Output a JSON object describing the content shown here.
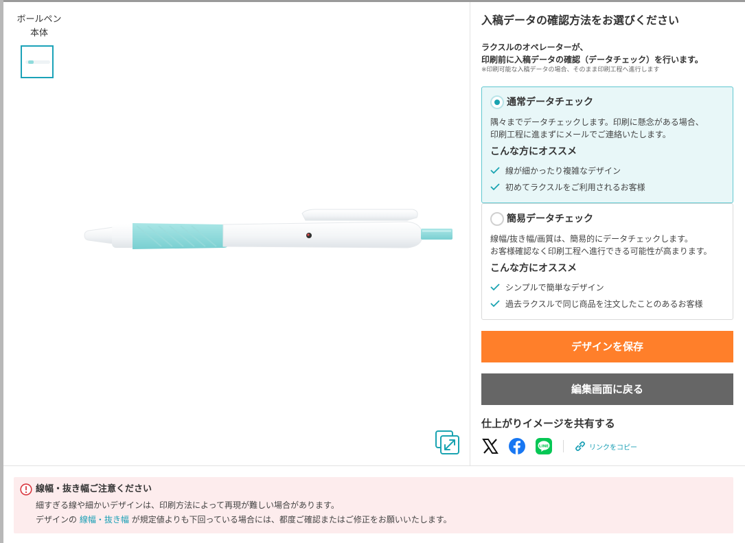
{
  "preview": {
    "thumb_label": "ボールペン本体"
  },
  "panel": {
    "title": "入稿データの確認方法をお選びください",
    "desc_line1": "ラクスルのオペレーターが、",
    "desc_line2": "印刷前に入稿データの確認（データチェック）を行います。",
    "note": "※印刷可能な入稿データの場合、そのまま印刷工程へ進行します",
    "options": [
      {
        "title": "通常データチェック",
        "selected": true,
        "body_line1": "隅々までデータチェックします。印刷に懸念がある場合、",
        "body_line2": "印刷工程に進まずにメールでご連絡いたします。",
        "recommend_title": "こんな方にオススメ",
        "checks": [
          "線が細かったり複雑なデザイン",
          "初めてラクスルをご利用されるお客様"
        ]
      },
      {
        "title": "簡易データチェック",
        "selected": false,
        "body_line1": "線幅/抜き幅/画質は、簡易的にデータチェックします。",
        "body_line2": "お客様確認なく印刷工程へ進行できる可能性が高まります。",
        "recommend_title": "こんな方にオススメ",
        "checks": [
          "シンプルで簡単なデザイン",
          "過去ラクスルで同じ商品を注文したことのあるお客様"
        ]
      }
    ],
    "save_label": "デザインを保存",
    "back_label": "編集画面に戻る",
    "share_title": "仕上がりイメージを共有する",
    "copy_link_label": "リンクをコピー"
  },
  "warning": {
    "title": "線幅・抜き幅ご注意ください",
    "line1": "細すぎる線や細かいデザインは、印刷方法によって再現が難しい場合があります。",
    "line2_prefix": "デザインの",
    "line2_link": "線幅・抜き幅",
    "line2_suffix": "が規定値よりも下回っている場合には、都度ご確認またはご修正をお願いいたします。"
  },
  "colors": {
    "accent": "#19a3b1",
    "save_button": "#ff7f2a",
    "back_button": "#666666",
    "selected_bg": "#e8f7f8",
    "warning_bg": "#fdeced",
    "warning_icon": "#d9363e",
    "grip": "#8fdbdc"
  },
  "icons": {
    "share": [
      "x-logo-icon",
      "facebook-icon",
      "line-icon"
    ],
    "copy": "link-icon",
    "expand": "expand-icon",
    "warning": "exclamation-circle-icon",
    "check": "check-icon"
  }
}
